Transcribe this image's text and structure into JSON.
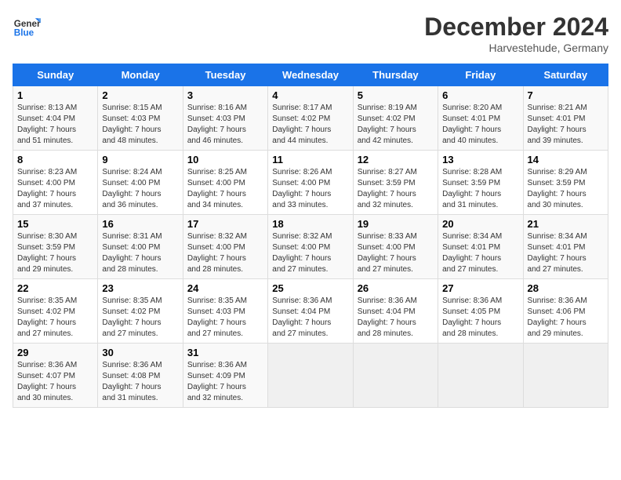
{
  "logo": {
    "line1": "General",
    "line2": "Blue"
  },
  "title": "December 2024",
  "location": "Harvestehude, Germany",
  "days_of_week": [
    "Sunday",
    "Monday",
    "Tuesday",
    "Wednesday",
    "Thursday",
    "Friday",
    "Saturday"
  ],
  "weeks": [
    [
      {
        "day": "1",
        "info": "Sunrise: 8:13 AM\nSunset: 4:04 PM\nDaylight: 7 hours\nand 51 minutes."
      },
      {
        "day": "2",
        "info": "Sunrise: 8:15 AM\nSunset: 4:03 PM\nDaylight: 7 hours\nand 48 minutes."
      },
      {
        "day": "3",
        "info": "Sunrise: 8:16 AM\nSunset: 4:03 PM\nDaylight: 7 hours\nand 46 minutes."
      },
      {
        "day": "4",
        "info": "Sunrise: 8:17 AM\nSunset: 4:02 PM\nDaylight: 7 hours\nand 44 minutes."
      },
      {
        "day": "5",
        "info": "Sunrise: 8:19 AM\nSunset: 4:02 PM\nDaylight: 7 hours\nand 42 minutes."
      },
      {
        "day": "6",
        "info": "Sunrise: 8:20 AM\nSunset: 4:01 PM\nDaylight: 7 hours\nand 40 minutes."
      },
      {
        "day": "7",
        "info": "Sunrise: 8:21 AM\nSunset: 4:01 PM\nDaylight: 7 hours\nand 39 minutes."
      }
    ],
    [
      {
        "day": "8",
        "info": "Sunrise: 8:23 AM\nSunset: 4:00 PM\nDaylight: 7 hours\nand 37 minutes."
      },
      {
        "day": "9",
        "info": "Sunrise: 8:24 AM\nSunset: 4:00 PM\nDaylight: 7 hours\nand 36 minutes."
      },
      {
        "day": "10",
        "info": "Sunrise: 8:25 AM\nSunset: 4:00 PM\nDaylight: 7 hours\nand 34 minutes."
      },
      {
        "day": "11",
        "info": "Sunrise: 8:26 AM\nSunset: 4:00 PM\nDaylight: 7 hours\nand 33 minutes."
      },
      {
        "day": "12",
        "info": "Sunrise: 8:27 AM\nSunset: 3:59 PM\nDaylight: 7 hours\nand 32 minutes."
      },
      {
        "day": "13",
        "info": "Sunrise: 8:28 AM\nSunset: 3:59 PM\nDaylight: 7 hours\nand 31 minutes."
      },
      {
        "day": "14",
        "info": "Sunrise: 8:29 AM\nSunset: 3:59 PM\nDaylight: 7 hours\nand 30 minutes."
      }
    ],
    [
      {
        "day": "15",
        "info": "Sunrise: 8:30 AM\nSunset: 3:59 PM\nDaylight: 7 hours\nand 29 minutes."
      },
      {
        "day": "16",
        "info": "Sunrise: 8:31 AM\nSunset: 4:00 PM\nDaylight: 7 hours\nand 28 minutes."
      },
      {
        "day": "17",
        "info": "Sunrise: 8:32 AM\nSunset: 4:00 PM\nDaylight: 7 hours\nand 28 minutes."
      },
      {
        "day": "18",
        "info": "Sunrise: 8:32 AM\nSunset: 4:00 PM\nDaylight: 7 hours\nand 27 minutes."
      },
      {
        "day": "19",
        "info": "Sunrise: 8:33 AM\nSunset: 4:00 PM\nDaylight: 7 hours\nand 27 minutes."
      },
      {
        "day": "20",
        "info": "Sunrise: 8:34 AM\nSunset: 4:01 PM\nDaylight: 7 hours\nand 27 minutes."
      },
      {
        "day": "21",
        "info": "Sunrise: 8:34 AM\nSunset: 4:01 PM\nDaylight: 7 hours\nand 27 minutes."
      }
    ],
    [
      {
        "day": "22",
        "info": "Sunrise: 8:35 AM\nSunset: 4:02 PM\nDaylight: 7 hours\nand 27 minutes."
      },
      {
        "day": "23",
        "info": "Sunrise: 8:35 AM\nSunset: 4:02 PM\nDaylight: 7 hours\nand 27 minutes."
      },
      {
        "day": "24",
        "info": "Sunrise: 8:35 AM\nSunset: 4:03 PM\nDaylight: 7 hours\nand 27 minutes."
      },
      {
        "day": "25",
        "info": "Sunrise: 8:36 AM\nSunset: 4:04 PM\nDaylight: 7 hours\nand 27 minutes."
      },
      {
        "day": "26",
        "info": "Sunrise: 8:36 AM\nSunset: 4:04 PM\nDaylight: 7 hours\nand 28 minutes."
      },
      {
        "day": "27",
        "info": "Sunrise: 8:36 AM\nSunset: 4:05 PM\nDaylight: 7 hours\nand 28 minutes."
      },
      {
        "day": "28",
        "info": "Sunrise: 8:36 AM\nSunset: 4:06 PM\nDaylight: 7 hours\nand 29 minutes."
      }
    ],
    [
      {
        "day": "29",
        "info": "Sunrise: 8:36 AM\nSunset: 4:07 PM\nDaylight: 7 hours\nand 30 minutes."
      },
      {
        "day": "30",
        "info": "Sunrise: 8:36 AM\nSunset: 4:08 PM\nDaylight: 7 hours\nand 31 minutes."
      },
      {
        "day": "31",
        "info": "Sunrise: 8:36 AM\nSunset: 4:09 PM\nDaylight: 7 hours\nand 32 minutes."
      },
      {
        "day": "",
        "info": ""
      },
      {
        "day": "",
        "info": ""
      },
      {
        "day": "",
        "info": ""
      },
      {
        "day": "",
        "info": ""
      }
    ]
  ]
}
